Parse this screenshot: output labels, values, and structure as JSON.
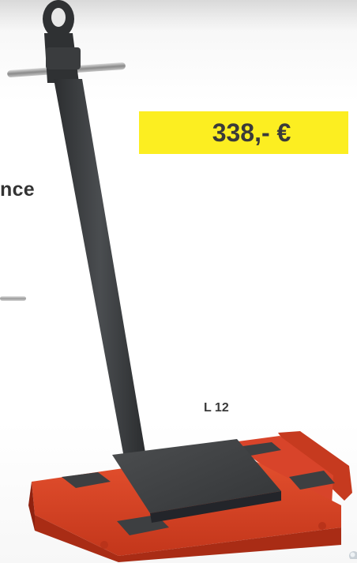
{
  "partial_heading": "nce",
  "price": "338,- €",
  "model": "L 12",
  "colors": {
    "price_bg": "#fcee21",
    "skate_red": "#d23a1e",
    "handle_dark": "#3b3d3f"
  },
  "icons": {
    "product": "transport-skate-image",
    "rod": "steel-rod-image"
  }
}
